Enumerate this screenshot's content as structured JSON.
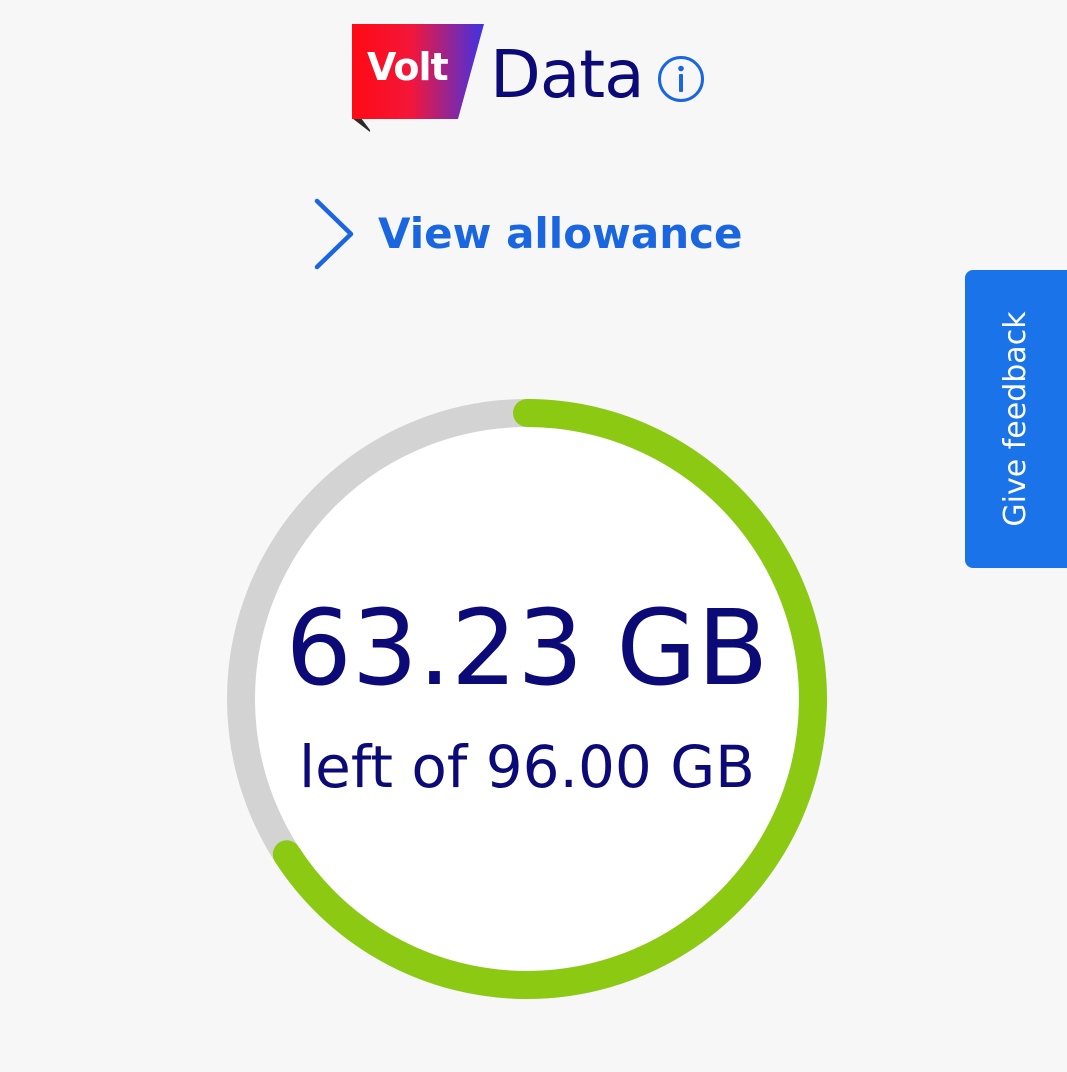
{
  "header": {
    "logo_text": "Volt",
    "title": "Data",
    "info_icon": "info-circle-icon"
  },
  "allowance": {
    "link_label": "View allowance",
    "icon": "chevron-right-icon"
  },
  "feedback": {
    "label": "Give feedback"
  },
  "usage": {
    "remaining_text": "63.23 GB",
    "total_text": "left of 96.00 GB",
    "remaining_gb": 63.23,
    "total_gb": 96.0
  },
  "colors": {
    "title_navy": "#0b0a77",
    "link_blue": "#1a66e0",
    "feedback_blue": "#1a73e8",
    "ring_green": "#8cc912",
    "ring_track": "#d3d3d3",
    "logo_gradient_start": "#ff0a14",
    "logo_gradient_end": "#3e32e6"
  }
}
